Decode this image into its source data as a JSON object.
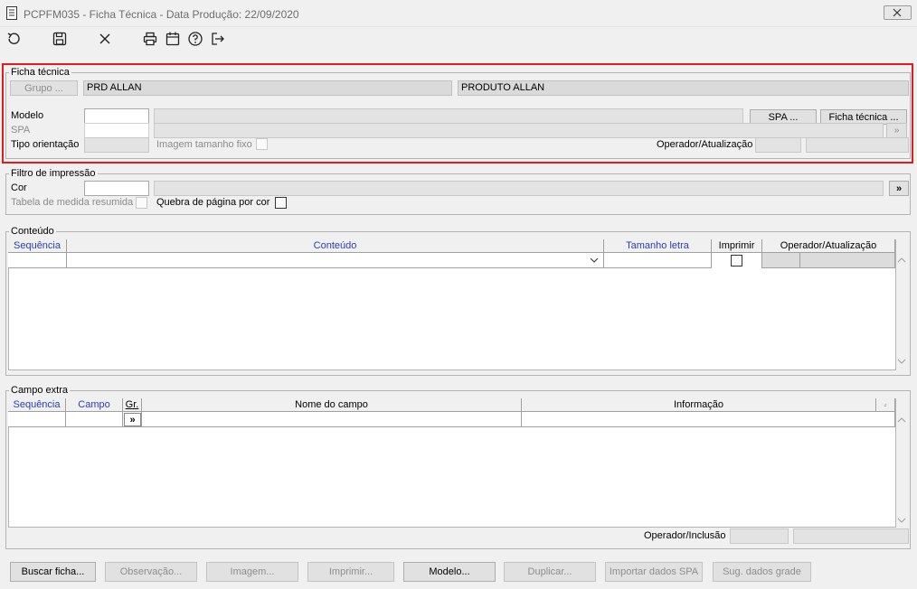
{
  "window": {
    "title": "PCPFM035 - Ficha Técnica - Data Produção: 22/09/2020",
    "close_glyph": "✕"
  },
  "toolbar": {
    "icons": [
      "undo-icon",
      "save-icon",
      "cancel-icon",
      "print-icon",
      "calendar-icon",
      "help-icon",
      "exit-icon"
    ]
  },
  "ficha": {
    "title": "Ficha técnica",
    "grupo_button": "Grupo ...",
    "grupo_code": "PRD ALLAN",
    "grupo_desc": "PRODUTO ALLAN",
    "modelo_label": "Modelo",
    "modelo_value": "",
    "spa_button": "SPA ...",
    "ficha_button": "Ficha técnica ...",
    "spa_label": "SPA",
    "spa_btn_glyph": "»",
    "tipo_label": "Tipo orientação",
    "imagem_label": "Imagem tamanho fixo",
    "operador_label": "Operador/Atualização"
  },
  "filtro": {
    "title": "Filtro de impressão",
    "cor_label": "Cor",
    "cor_btn": "»",
    "tabela_label": "Tabela de medida resumida",
    "quebra_label": "Quebra de página por cor"
  },
  "conteudo": {
    "title": "Conteúdo",
    "columns": [
      "Sequência",
      "Conteúdo",
      "Tamanho letra",
      "Imprimir",
      "Operador/Atualização"
    ]
  },
  "campo_extra": {
    "title": "Campo extra",
    "columns": [
      "Sequência",
      "Campo",
      "Gr.",
      "Nome do campo",
      "Informação"
    ],
    "row_btn": "»",
    "operador_label": "Operador/Inclusão"
  },
  "footer": {
    "buttons": [
      {
        "label": "Buscar ficha...",
        "enabled": true
      },
      {
        "label": "Observação...",
        "enabled": false
      },
      {
        "label": "Imagem...",
        "enabled": false
      },
      {
        "label": "Imprimir...",
        "enabled": false
      },
      {
        "label": "Modelo...",
        "enabled": true
      },
      {
        "label": "Duplicar...",
        "enabled": false
      },
      {
        "label": "Importar dados SPA",
        "enabled": false
      },
      {
        "label": "Sug. dados grade",
        "enabled": false
      }
    ]
  }
}
